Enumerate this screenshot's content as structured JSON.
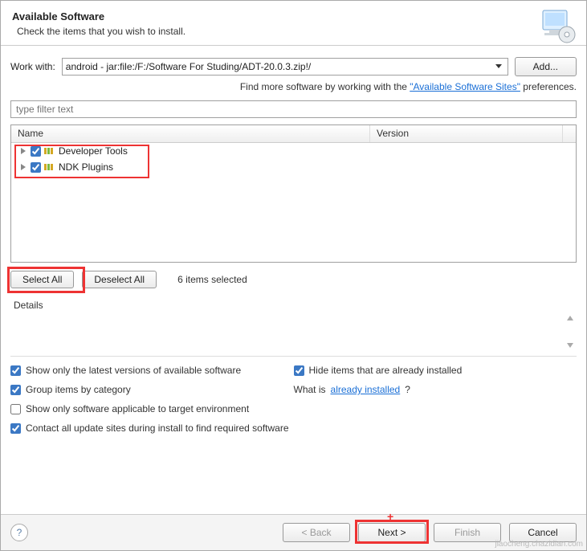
{
  "header": {
    "title": "Available Software",
    "subtitle": "Check the items that you wish to install."
  },
  "workwith": {
    "label": "Work with:",
    "value": "android - jar:file:/F:/Software For Studing/ADT-20.0.3.zip!/",
    "add_button": "Add..."
  },
  "findmore": {
    "prefix": "Find more software by working with the ",
    "link": "\"Available Software Sites\"",
    "suffix": " preferences."
  },
  "filter": {
    "placeholder": "type filter text"
  },
  "tree": {
    "col_name": "Name",
    "col_version": "Version",
    "items": [
      {
        "label": "Developer Tools",
        "checked": true
      },
      {
        "label": "NDK Plugins",
        "checked": true
      }
    ]
  },
  "selection": {
    "select_all": "Select All",
    "deselect_all": "Deselect All",
    "count": "6 items selected"
  },
  "details": {
    "label": "Details"
  },
  "options": {
    "show_latest": {
      "label": "Show only the latest versions of available software",
      "checked": true
    },
    "hide_installed": {
      "label": "Hide items that are already installed",
      "checked": true
    },
    "group_category": {
      "label": "Group items by category",
      "checked": true
    },
    "what_is_prefix": "What is ",
    "what_is_link": "already installed",
    "what_is_suffix": "?",
    "applicable": {
      "label": "Show only software applicable to target environment",
      "checked": false
    },
    "contact_all": {
      "label": "Contact all update sites during install to find required software",
      "checked": true
    }
  },
  "footer": {
    "back": "< Back",
    "next": "Next >",
    "finish": "Finish",
    "cancel": "Cancel"
  },
  "watermark": "jiaocheng.chazidian.com"
}
